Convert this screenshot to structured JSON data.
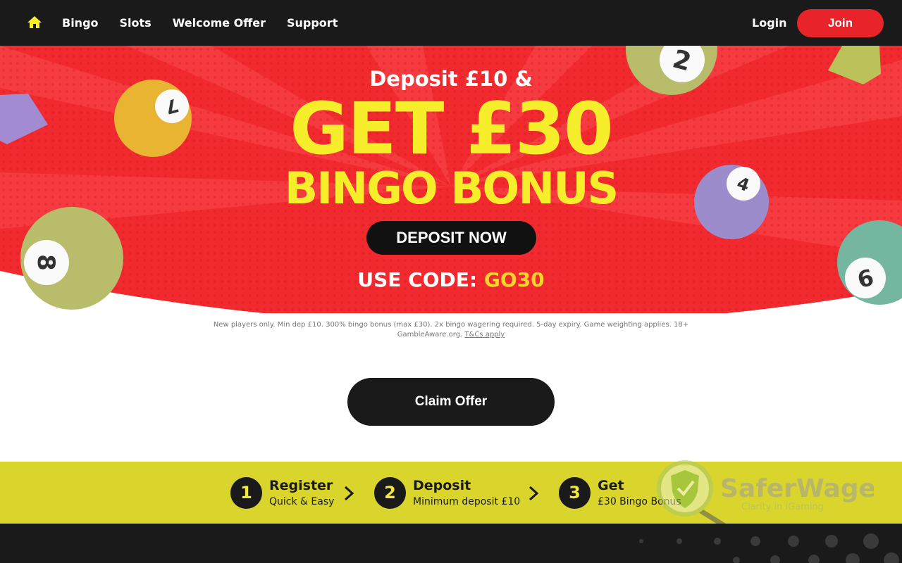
{
  "nav": {
    "links": [
      "Bingo",
      "Slots",
      "Welcome Offer",
      "Support"
    ],
    "login": "Login",
    "join": "Join"
  },
  "hero": {
    "line1": "Deposit £10 &",
    "line2": "GET £30",
    "line3": "BINGO BONUS",
    "deposit_button": "DEPOSIT NOW",
    "code_label": "USE CODE:",
    "code_value": "GO30",
    "balls": [
      "7",
      "2",
      "4",
      "8",
      "6"
    ]
  },
  "terms": {
    "text": "New players only. Min dep £10. 300% bingo bonus (max £30). 2x bingo wagering required. 5-day expiry. Game weighting applies. 18+ GambleAware.org.",
    "link": "T&Cs apply"
  },
  "claim_button": "Claim Offer",
  "steps": [
    {
      "num": "1",
      "title": "Register",
      "desc": "Quick & Easy"
    },
    {
      "num": "2",
      "title": "Deposit",
      "desc": "Minimum deposit £10"
    },
    {
      "num": "3",
      "title": "Get",
      "desc": "£30 Bingo Bonus"
    }
  ],
  "watermark": {
    "name": "SaferWager",
    "tagline": "Clarity in iGaming"
  },
  "colors": {
    "nav_bg": "#1a1a1a",
    "hero_red": "#f02a2f",
    "accent_yellow": "#f7ee2b",
    "join_red": "#e8232a",
    "steps_bg": "#d9d52c"
  }
}
